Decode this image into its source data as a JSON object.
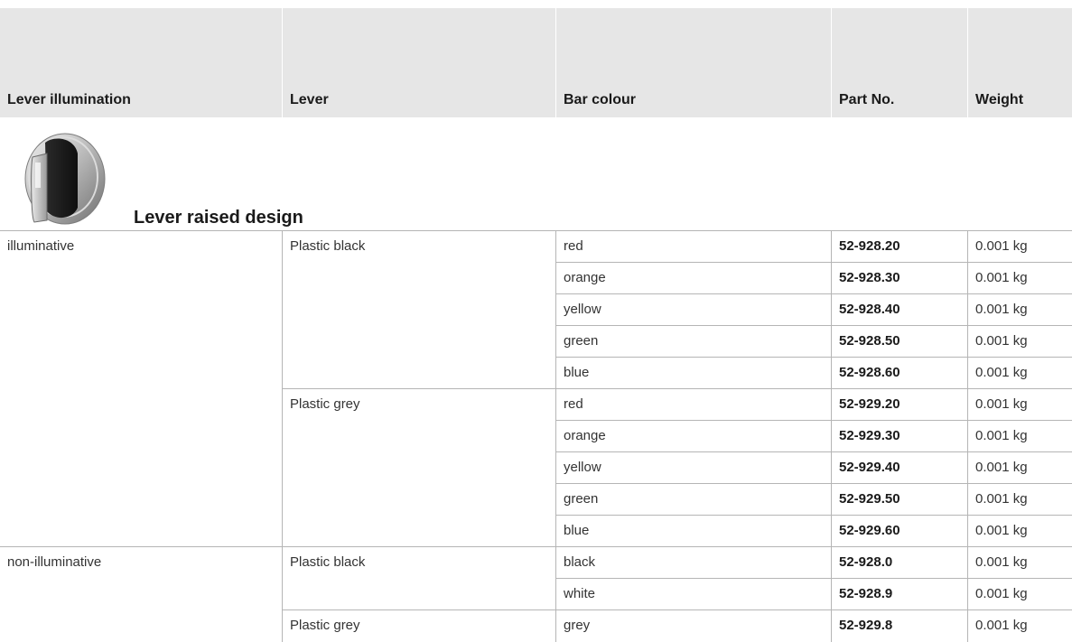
{
  "headers": {
    "lever_illumination": "Lever illumination",
    "lever": "Lever",
    "bar_colour": "Bar colour",
    "part_no": "Part No.",
    "weight": "Weight"
  },
  "section_title": "Lever raised design",
  "product_image": "lever-knob-image",
  "rows": [
    {
      "illumination": "illuminative",
      "lever": "Plastic black",
      "colour": "red",
      "part": "52-928.20",
      "weight": "0.001 kg"
    },
    {
      "illumination": "",
      "lever": "",
      "colour": "orange",
      "part": "52-928.30",
      "weight": "0.001 kg"
    },
    {
      "illumination": "",
      "lever": "",
      "colour": "yellow",
      "part": "52-928.40",
      "weight": "0.001 kg"
    },
    {
      "illumination": "",
      "lever": "",
      "colour": "green",
      "part": "52-928.50",
      "weight": "0.001 kg"
    },
    {
      "illumination": "",
      "lever": "",
      "colour": "blue",
      "part": "52-928.60",
      "weight": "0.001 kg"
    },
    {
      "illumination": "",
      "lever": "Plastic grey",
      "colour": "red",
      "part": "52-929.20",
      "weight": "0.001 kg"
    },
    {
      "illumination": "",
      "lever": "",
      "colour": "orange",
      "part": "52-929.30",
      "weight": "0.001 kg"
    },
    {
      "illumination": "",
      "lever": "",
      "colour": "yellow",
      "part": "52-929.40",
      "weight": "0.001 kg"
    },
    {
      "illumination": "",
      "lever": "",
      "colour": "green",
      "part": "52-929.50",
      "weight": "0.001 kg"
    },
    {
      "illumination": "",
      "lever": "",
      "colour": "blue",
      "part": "52-929.60",
      "weight": "0.001 kg"
    },
    {
      "illumination": "non-illuminative",
      "lever": "Plastic black",
      "colour": "black",
      "part": "52-928.0",
      "weight": "0.001 kg"
    },
    {
      "illumination": "",
      "lever": "",
      "colour": "white",
      "part": "52-928.9",
      "weight": "0.001 kg"
    },
    {
      "illumination": "",
      "lever": "Plastic grey",
      "colour": "grey",
      "part": "52-929.8",
      "weight": "0.001 kg"
    }
  ],
  "colors": {
    "header_bg": "#e6e6e6",
    "grid_line": "#b5b5b5",
    "text": "#1a1a1a"
  }
}
